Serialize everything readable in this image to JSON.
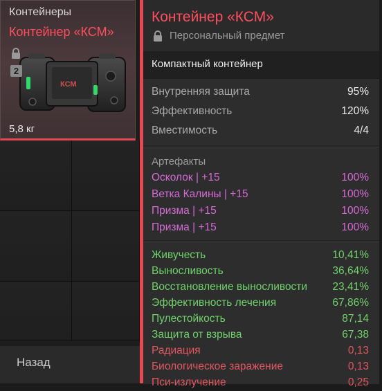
{
  "inventory": {
    "category": "Контейнеры",
    "back_label": "Назад"
  },
  "item_card": {
    "name": "Контейнер «КСМ»",
    "tier": "2",
    "weight": "5,8 кг",
    "image_text": "КСМ"
  },
  "tooltip": {
    "title": "Контейнер «КСМ»",
    "subtitle": "Персональный предмет",
    "description": "Компактный контейнер",
    "basic_stats": [
      {
        "label": "Внутренняя защита",
        "value": "95%"
      },
      {
        "label": "Эффективность",
        "value": "120%"
      },
      {
        "label": "Вместимость",
        "value": "4/4"
      }
    ],
    "artifacts_heading": "Артефакты",
    "artifacts": [
      {
        "label": "Осколок | +15",
        "value": "100%"
      },
      {
        "label": "Ветка Калины | +15",
        "value": "100%"
      },
      {
        "label": "Призма | +15",
        "value": "100%"
      },
      {
        "label": "Призма | +15",
        "value": "100%"
      }
    ],
    "effects": [
      {
        "label": "Живучесть",
        "value": "10,41%",
        "kind": "pos"
      },
      {
        "label": "Выносливость",
        "value": "36,64%",
        "kind": "pos"
      },
      {
        "label": "Восстановление выносливости",
        "value": "23,41%",
        "kind": "pos"
      },
      {
        "label": "Эффективность лечения",
        "value": "67,86%",
        "kind": "pos"
      },
      {
        "label": "Пулестойкость",
        "value": "87,14",
        "kind": "pos"
      },
      {
        "label": "Защита от взрыва",
        "value": "67,38",
        "kind": "pos"
      },
      {
        "label": "Радиация",
        "value": "0,13",
        "kind": "neg"
      },
      {
        "label": "Биологическое заражение",
        "value": "0,13",
        "kind": "neg"
      },
      {
        "label": "Пси-излучение",
        "value": "0,25",
        "kind": "neg"
      }
    ]
  },
  "colors": {
    "accent_red": "#e34a55",
    "positive_green": "#6fd36a",
    "artifact_pink": "#d46bd6",
    "negative_red": "#e3565f"
  },
  "icons": {
    "lock": "lock-icon",
    "tier": "tier-badge"
  }
}
